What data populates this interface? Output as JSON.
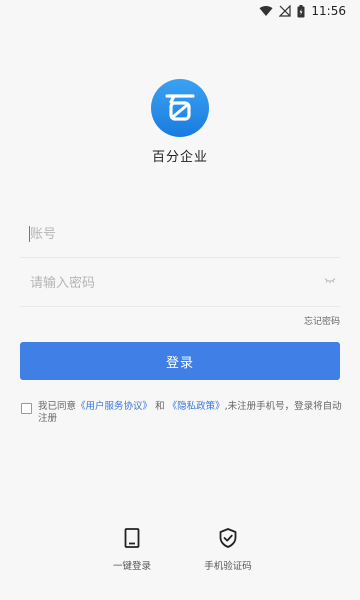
{
  "status_bar": {
    "time": "11:56"
  },
  "app": {
    "name": "百分企业",
    "logo_icon": "baifen-logo-icon",
    "logo_color": "#1a7be0"
  },
  "form": {
    "account_placeholder": "账号",
    "password_placeholder": "请输入密码",
    "forgot_password": "忘记密码",
    "login_button": "登录",
    "accent_color": "#3f7fe6"
  },
  "agreement": {
    "prefix": "我已同意",
    "user_agreement": "《用户服务协议》",
    "and": "和",
    "privacy_policy": "《隐私政策》",
    "suffix": ",未注册手机号，登录将自动注册",
    "checked": false
  },
  "quick_login": {
    "one_key": "一键登录",
    "sms": "手机验证码"
  }
}
